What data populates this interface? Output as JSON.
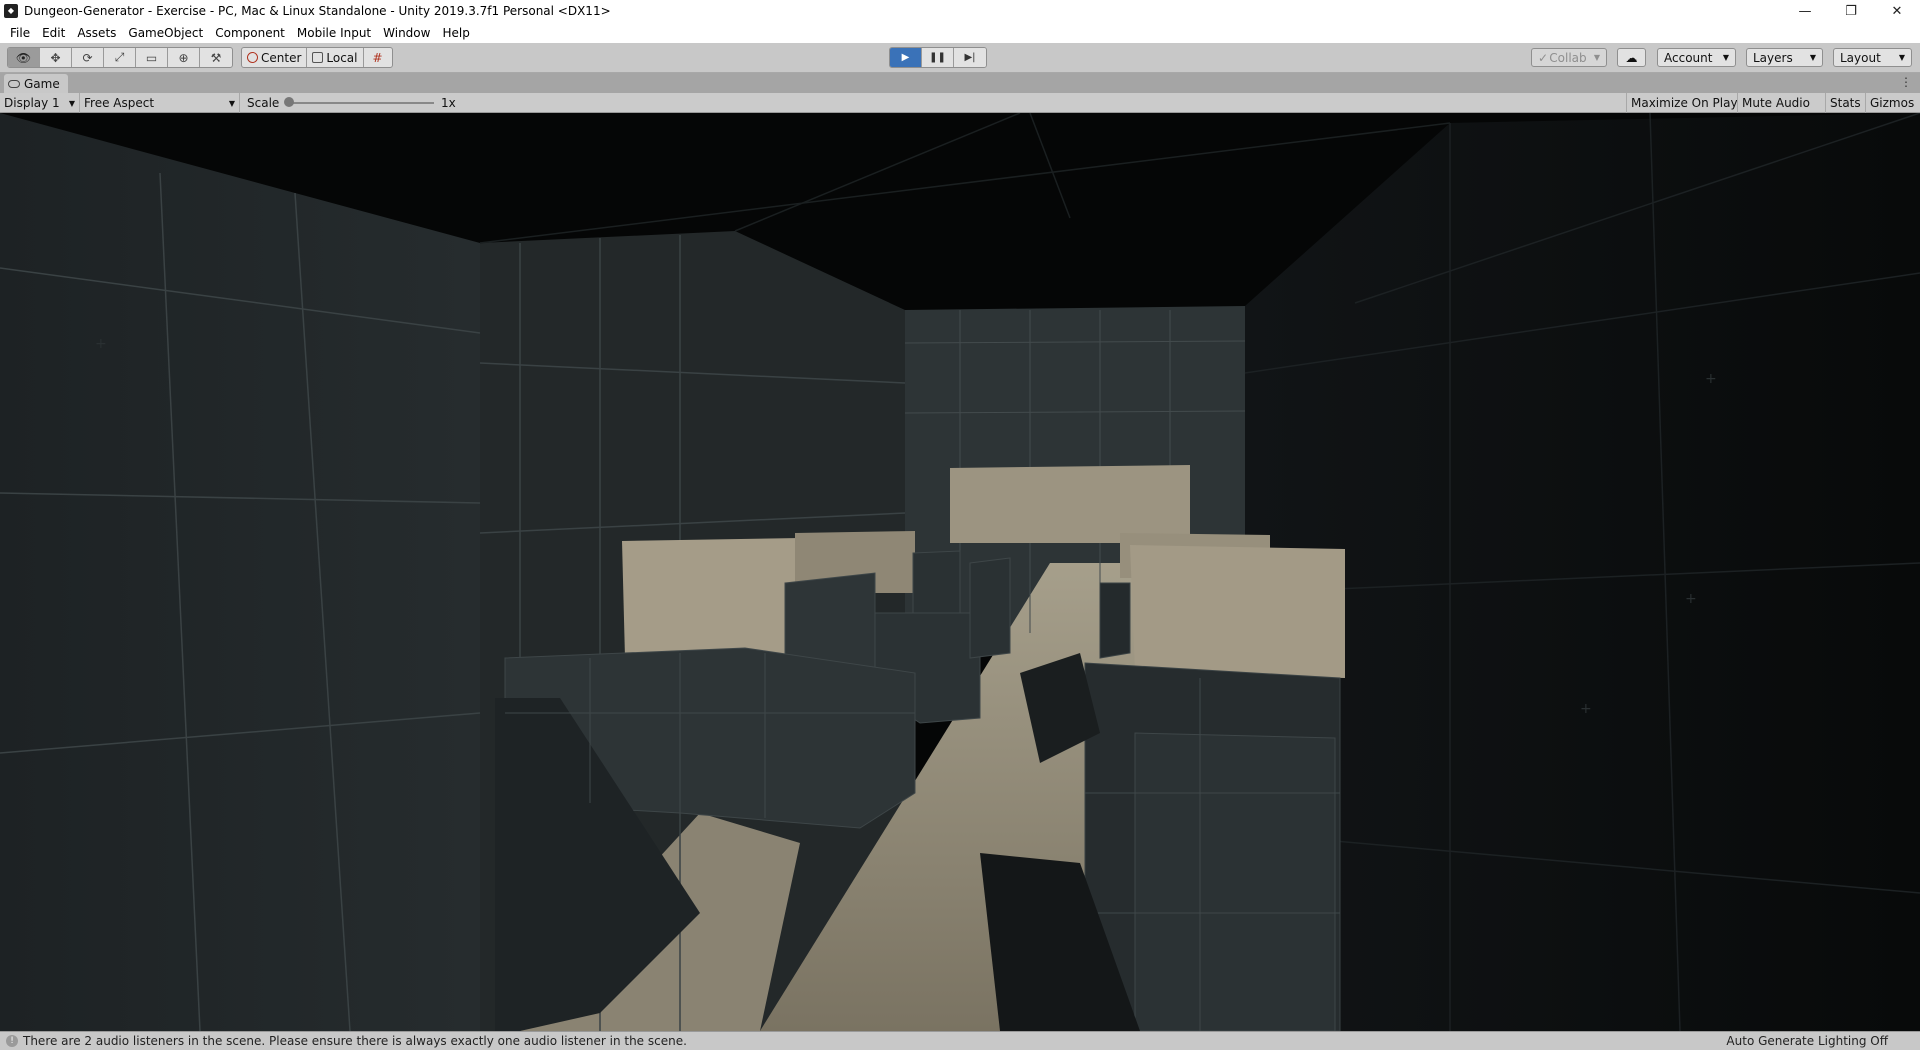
{
  "window": {
    "title": "Dungeon-Generator - Exercise - PC, Mac & Linux Standalone - Unity 2019.3.7f1 Personal <DX11>",
    "app_icon": "unity-icon",
    "controls": {
      "minimize": "—",
      "restore": "❐",
      "close": "✕"
    }
  },
  "menu": [
    "File",
    "Edit",
    "Assets",
    "GameObject",
    "Component",
    "Mobile Input",
    "Window",
    "Help"
  ],
  "toolbar": {
    "tools": [
      {
        "icon": "hand-view-icon",
        "glyph": "👁"
      },
      {
        "icon": "move-tool-icon",
        "glyph": "✥"
      },
      {
        "icon": "rotate-tool-icon",
        "glyph": "⟳"
      },
      {
        "icon": "scale-tool-icon",
        "glyph": "⤢"
      },
      {
        "icon": "rect-tool-icon",
        "glyph": "▭"
      },
      {
        "icon": "transform-tool-icon",
        "glyph": "⊕"
      },
      {
        "icon": "custom-tool-icon",
        "glyph": "⚒"
      }
    ],
    "pivot_center": "Center",
    "pivot_local": "Local",
    "snap_icon": "grid-snap-icon",
    "play_glyph": "▶",
    "pause_glyph": "❚❚",
    "step_glyph": "▶|",
    "collab": "Collab",
    "collab_check": "✓",
    "cloud_icon": "cloud-icon",
    "account": "Account",
    "layers": "Layers",
    "layout": "Layout",
    "caret": "▼"
  },
  "tab": {
    "label": "Game",
    "kebab": "⋮"
  },
  "game_toolbar": {
    "display": "Display 1",
    "aspect": "Free Aspect",
    "scale_label": "Scale",
    "scale_value": "1x",
    "maximize_on_play": "Maximize On Play",
    "mute_audio": "Mute Audio",
    "stats": "Stats",
    "gizmos": "Gizmos"
  },
  "status": {
    "warning_glyph": "!",
    "message": "There are 2 audio listeners in the scene. Please ensure there is always exactly one audio listener in the scene.",
    "right": "Auto Generate Lighting Off"
  },
  "colors": {
    "play_active": "#3a72b8",
    "floor": "#8c8472",
    "wall_dark": "#24292b",
    "panel_light": "#a59c88"
  }
}
